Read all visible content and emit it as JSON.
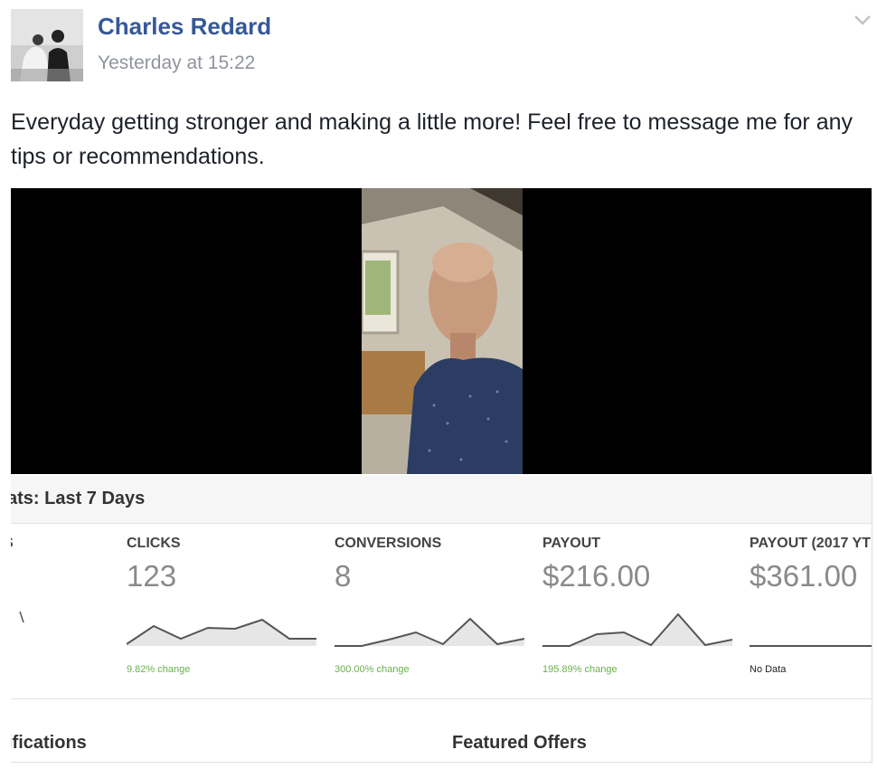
{
  "post": {
    "author": "Charles Redard",
    "timestamp": "Yesterday at 15:22",
    "text": "Everyday getting stronger and making a little more! Feel free to message me for any tips or recommendations."
  },
  "icons": {
    "options": "chevron-down-icon",
    "avatar": "profile-photo",
    "video": "video-thumbnail"
  },
  "dashboard": {
    "title": "ats: Last 7 Days",
    "stats": [
      {
        "label": "S",
        "value": "",
        "change": "",
        "trend": []
      },
      {
        "label": "CLICKS",
        "value": "123",
        "change": "9.82% change",
        "trend": [
          2,
          22,
          8,
          20,
          19,
          29,
          8,
          8
        ]
      },
      {
        "label": "CONVERSIONS",
        "value": "8",
        "change": "300.00% change",
        "trend": [
          0,
          0,
          7,
          15,
          2,
          30,
          2,
          8
        ]
      },
      {
        "label": "PAYOUT",
        "value": "$216.00",
        "change": "195.89% change",
        "trend": [
          0,
          0,
          13,
          15,
          1,
          35,
          1,
          7
        ]
      },
      {
        "label": "PAYOUT (2017 YT",
        "value": "$361.00",
        "change": "No Data",
        "trend": [
          0,
          0,
          0,
          0,
          0,
          0,
          0,
          3
        ]
      }
    ],
    "sections": [
      "ifications",
      "Featured Offers"
    ]
  },
  "colors": {
    "author": "#365899",
    "timestamp": "#90949c",
    "change_positive": "#6ab04c",
    "spark_line": "#555555",
    "spark_fill": "#e6e6e6"
  }
}
